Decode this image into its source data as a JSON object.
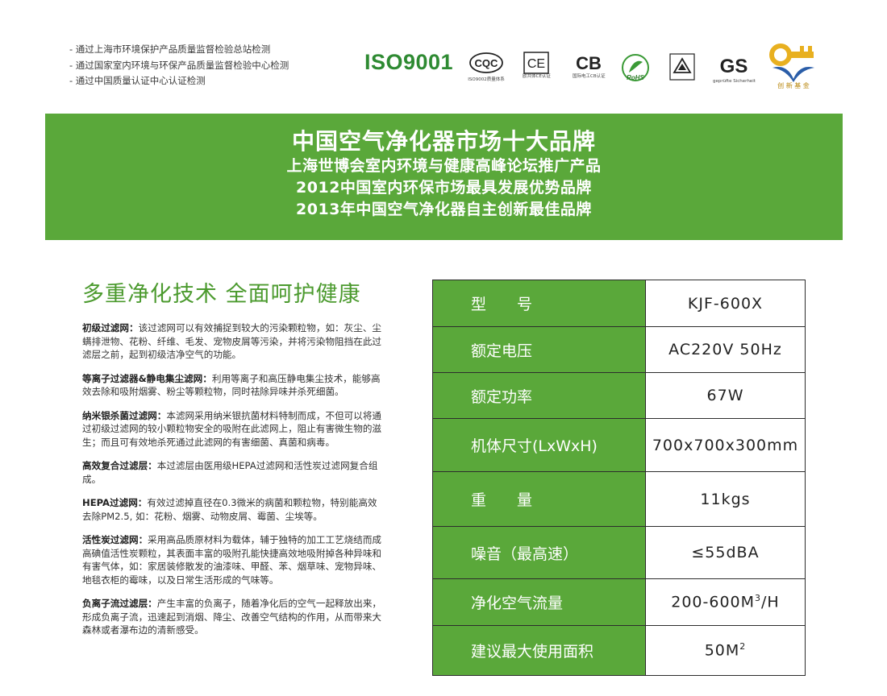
{
  "certs": [
    "- 通过上海市环境保护产品质量监督检验总站检测",
    "- 通过国家室内环境与环保产品质量监督检验中心检测",
    "- 通过中国质量认证中心认证检测"
  ],
  "logos": {
    "iso": "ISO9001",
    "cqc_text": "CQC",
    "cqc_caption": "ISO9002质量体系",
    "ce_text": "CE",
    "ce_caption": "欧共体CE认证",
    "cb_text": "CB",
    "cb_caption": "国际电工CB认证",
    "rohs_text": "RoHS",
    "gs_text": "GS",
    "gs_caption": "geprüfte Sicherheit",
    "fund_caption": "创 新 基 金"
  },
  "banner": {
    "line1": "中国空气净化器市场十大品牌",
    "line2": "上海世博会室内环境与健康高峰论坛推广产品",
    "line3": "2012中国室内环保市场最具发展优势品牌",
    "line4": "2013年中国空气净化器自主创新最佳品牌"
  },
  "headline": "多重净化技术 全面呵护健康",
  "filters": [
    {
      "title": "初级过滤网：",
      "text": "该过滤网可以有效捕捉到较大的污染颗粒物，如：灰尘、尘螨排泄物、花粉、纤维、毛发、宠物皮屑等污染，并将污染物阻挡在此过滤层之前，起到初级洁净空气的功能。"
    },
    {
      "title": "等离子过滤器&静电集尘滤网：",
      "text": "利用等离子和高压静电集尘技术，能够高效去除和吸附烟雾、粉尘等颗粒物，同时祛除异味并杀死细菌。"
    },
    {
      "title": "纳米银杀菌过滤网：",
      "text": "本滤网采用纳米银抗菌材料特制而成，不但可以将通过初级过滤网的较小颗粒物安全的吸附在此滤网上，阻止有害微生物的滋生；而且可有效地杀死通过此滤网的有害细菌、真菌和病毒。"
    },
    {
      "title": "高效复合过滤层：",
      "text": "本过滤层由医用级HEPA过滤网和活性炭过滤网复合组成。"
    },
    {
      "title": "HEPA过滤网：",
      "text": "有效过滤掉直径在0.3微米的病菌和颗粒物，特别能高效去除PM2.5, 如：花粉、烟雾、动物皮屑、霉菌、尘埃等。"
    },
    {
      "title": "活性炭过滤网：",
      "text": "采用高品质原材料为载体，辅于独特的加工工艺烧结而成高碘值活性炭颗粒，其表面丰富的吸附孔能快捷高效地吸附掉各种异味和有害气体，如：家居装修散发的油漆味、甲醛、苯、烟草味、宠物异味、地毯衣柜的霉味，以及日常生活形成的气味等。"
    },
    {
      "title": "负离子流过滤层：",
      "text": "产生丰富的负离子，随着净化后的空气一起释放出来，形成负离子流，迅速起到消烟、降尘、改善空气结构的作用，从而带来大森林或者瀑布边的清新感受。"
    }
  ],
  "specs": [
    {
      "label": "型　　号",
      "value": "KJF-600X"
    },
    {
      "label": "额定电压",
      "value": "AC220V 50Hz"
    },
    {
      "label": "额定功率",
      "value": "67W"
    },
    {
      "label": "机体尺寸(LxWxH)",
      "value": "700x700x300mm"
    },
    {
      "label": "重　　量",
      "value": "11kgs"
    },
    {
      "label": "噪音（最高速）",
      "value": "≤55dBA"
    },
    {
      "label": "净化空气流量",
      "value": "200-600M",
      "sup": "3",
      "suffix": "/H"
    },
    {
      "label": "建议最大使用面积",
      "value": "50M",
      "sup": "2",
      "suffix": ""
    }
  ],
  "colors": {
    "brand_green": "#5aa83a",
    "iso_green": "#2e8a32",
    "fund_gold": "#e8b020",
    "fund_blue": "#2a5da8"
  }
}
